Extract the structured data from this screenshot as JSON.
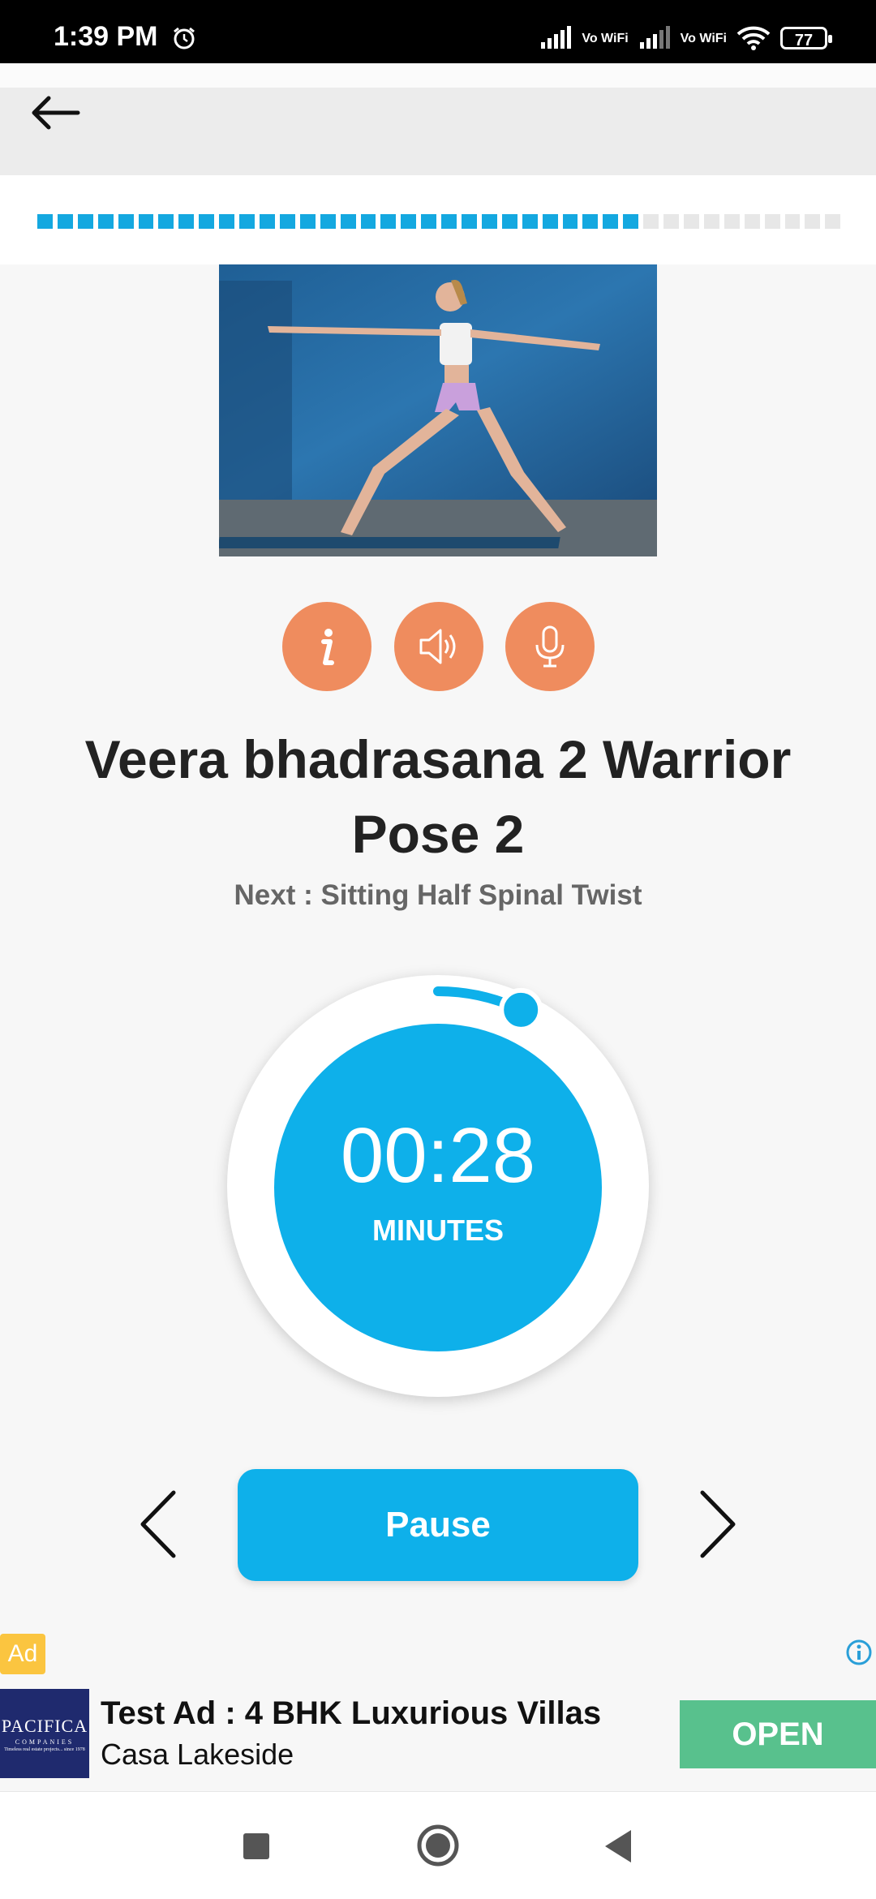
{
  "status_bar": {
    "time": "1:39 PM",
    "battery": "77",
    "network_labels": [
      "Vo WiFi",
      "Vo WiFi"
    ]
  },
  "progress": {
    "total_segments": 40,
    "completed_segments": 30
  },
  "pose": {
    "title": "Veera bhadrasana 2 Warrior Pose 2",
    "next_text": "Next : Sitting Half Spinal Twist"
  },
  "controls": {
    "info_icon": "info-icon",
    "sound_icon": "speaker-icon",
    "mic_icon": "microphone-icon"
  },
  "timer": {
    "value": "00:28",
    "unit": "MINUTES",
    "elapsed_fraction": 0.07
  },
  "actions": {
    "pause_label": "Pause"
  },
  "ad": {
    "badge": "Ad",
    "logo_brand": "PACIFICA",
    "logo_sub": "COMPANIES",
    "logo_tag": "Timeless real estate projects... since 1978",
    "title": "Test Ad : 4 BHK Luxurious Villas",
    "subtitle": "Casa Lakeside",
    "cta": "OPEN"
  },
  "colors": {
    "accent_blue": "#0eb0ea",
    "orange": "#ef8c5e",
    "ad_green": "#58c18d",
    "ad_badge": "#fbc540"
  }
}
